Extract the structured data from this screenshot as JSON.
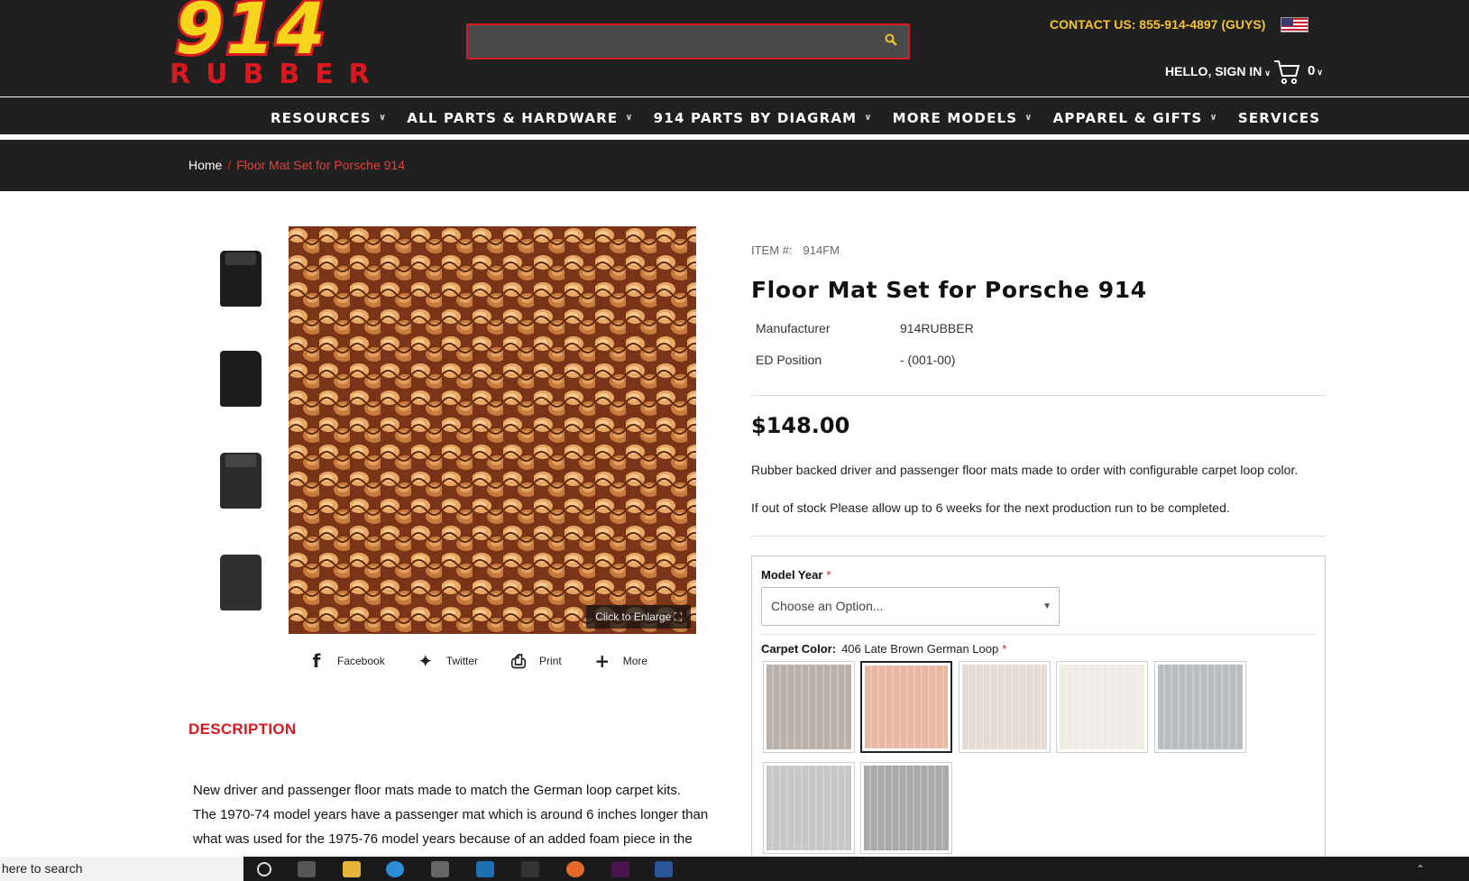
{
  "brand": {
    "logo_number": "914",
    "logo_word": "RUBBER"
  },
  "header": {
    "contact": "CONTACT US: 855-914-4897 (GUYS)",
    "signin": "HELLO, SIGN IN",
    "cart_count": "0"
  },
  "nav": {
    "items": [
      {
        "label": "RESOURCES",
        "dropdown": true
      },
      {
        "label": "ALL PARTS & HARDWARE",
        "dropdown": true
      },
      {
        "label": "914 PARTS BY DIAGRAM",
        "dropdown": true
      },
      {
        "label": "MORE MODELS",
        "dropdown": true
      },
      {
        "label": "APPAREL & GIFTS",
        "dropdown": true
      },
      {
        "label": "SERVICES",
        "dropdown": false
      }
    ]
  },
  "breadcrumb": {
    "home": "Home",
    "separator": "/",
    "current": "Floor Mat Set for Porsche 914"
  },
  "gallery": {
    "enlarge": "Click to Enlarge"
  },
  "share": {
    "facebook": "Facebook",
    "twitter": "Twitter",
    "print": "Print",
    "more": "More"
  },
  "description": {
    "heading": "DESCRIPTION",
    "lines": [
      "New driver and passenger floor mats made to match the German loop carpet kits.",
      "The 1970-74 model years have a passenger mat which is around 6 inches longer than",
      "what was used for the 1975-76 model years because of an added foam piece in the"
    ]
  },
  "product": {
    "item_label": "ITEM #:",
    "item_value": "914FM",
    "title": "Floor Mat Set for Porsche 914",
    "specs": [
      {
        "key": "Manufacturer",
        "value": "914RUBBER"
      },
      {
        "key": "ED Position",
        "value": "- (001-00)"
      }
    ],
    "price": "$148.00",
    "summary": "Rubber backed driver and passenger floor mats made to order with configurable carpet loop color.",
    "stock_note": "If out of stock Please allow up to 6 weeks for the next production run to be completed."
  },
  "options": {
    "model_year_label": "Model Year",
    "required_mark": "*",
    "model_year_placeholder": "Choose an Option...",
    "carpet_label": "Carpet Color:",
    "carpet_value": "406 Late Brown German Loop",
    "swatch_colors": [
      "#b9b0a9",
      "#e7b8a0",
      "#e4dcd4",
      "#eeece4",
      "#b9bcc1",
      "#c7c7c7",
      "#a9a9ab"
    ],
    "selected_swatch": 1
  },
  "taskbar": {
    "search": "here to search"
  },
  "colors": {
    "accent": "#d8191f",
    "logo_yellow": "#f7d51d",
    "contact": "#f4c430",
    "header_bg": "#202020"
  }
}
